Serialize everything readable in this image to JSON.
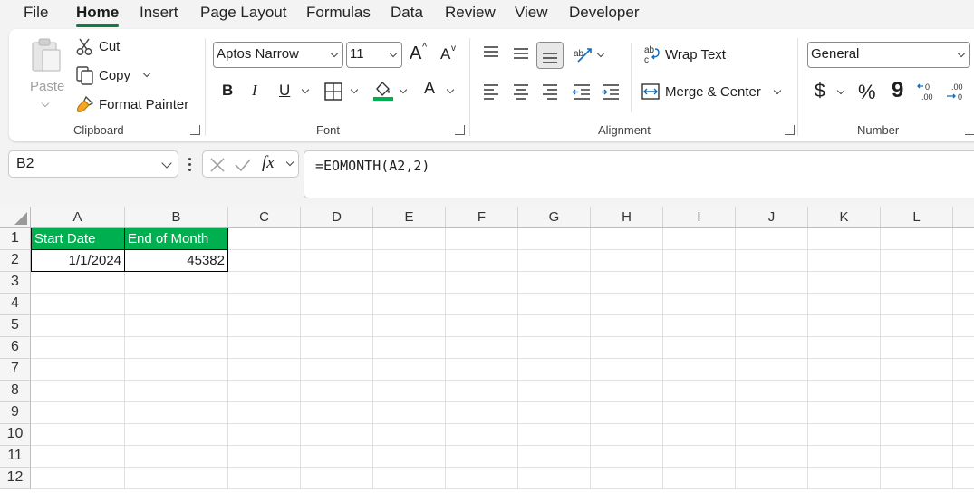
{
  "menu": {
    "tabs": [
      {
        "label": "File"
      },
      {
        "label": "Home"
      },
      {
        "label": "Insert"
      },
      {
        "label": "Page Layout"
      },
      {
        "label": "Formulas"
      },
      {
        "label": "Data"
      },
      {
        "label": "Review"
      },
      {
        "label": "View"
      },
      {
        "label": "Developer"
      }
    ],
    "active": "Home"
  },
  "ribbon": {
    "clipboard": {
      "paste": "Paste",
      "cut": "Cut",
      "copy": "Copy",
      "format_painter": "Format Painter",
      "label": "Clipboard"
    },
    "font": {
      "family": "Aptos Narrow",
      "size": "11",
      "bold": "B",
      "italic": "I",
      "underline": "U",
      "grow": "A",
      "shrink": "A",
      "font_color": "A",
      "label": "Font"
    },
    "alignment": {
      "wrap_text": "Wrap Text",
      "merge_center": "Merge & Center",
      "label": "Alignment"
    },
    "number": {
      "format": "General",
      "currency": "$",
      "percent": "%",
      "comma": "9",
      "label": "Number"
    }
  },
  "formula_bar": {
    "name_box": "B2",
    "fx": "fx",
    "formula": "=EOMONTH(A2,2)"
  },
  "sheet": {
    "columns": [
      "A",
      "B",
      "C",
      "D",
      "E",
      "F",
      "G",
      "H",
      "I",
      "J",
      "K",
      "L"
    ],
    "rows": [
      "1",
      "2",
      "3",
      "4",
      "5",
      "6",
      "7",
      "8",
      "9",
      "10",
      "11",
      "12"
    ],
    "cells": {
      "A1": "Start Date",
      "B1": "End of Month",
      "A2": "1/1/2024",
      "B2": "45382"
    },
    "header_fill": "#00b050",
    "accent": "#107c41"
  }
}
